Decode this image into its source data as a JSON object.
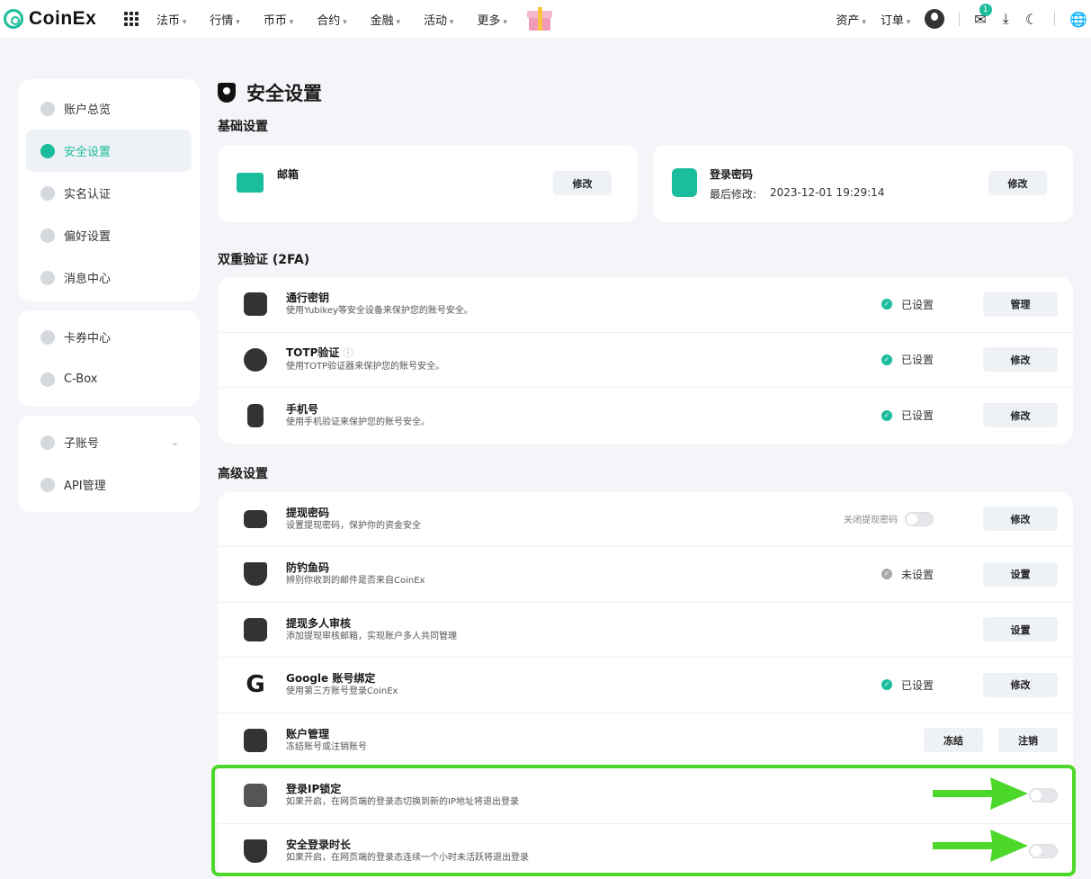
{
  "brand": {
    "name": "CoinEx"
  },
  "nav": [
    "法币",
    "行情",
    "币币",
    "合约",
    "金融",
    "活动",
    "更多"
  ],
  "topright": {
    "assets": "资产",
    "orders": "订单",
    "msg_count": "1"
  },
  "sidebar": {
    "group1": [
      "账户总览",
      "安全设置",
      "实名认证",
      "偏好设置",
      "消息中心"
    ],
    "group2": [
      "卡券中心",
      "C-Box"
    ],
    "group3": [
      "子账号",
      "API管理"
    ]
  },
  "page": {
    "title": "安全设置",
    "basic": {
      "title": "基础设置",
      "email": {
        "label": "邮箱",
        "button": "修改"
      },
      "password": {
        "label": "登录密码",
        "last_modified_label": "最后修改:",
        "last_modified": "2023-12-01 19:29:14",
        "button": "修改"
      }
    },
    "twofa": {
      "title": "双重验证 (2FA)",
      "rows": [
        {
          "title": "通行密钥",
          "desc": "使用Yubikey等安全设备来保护您的账号安全。",
          "status": "已设置",
          "button": "管理"
        },
        {
          "title": "TOTP验证",
          "desc": "使用TOTP验证器来保护您的账号安全。",
          "status": "已设置",
          "button": "修改"
        },
        {
          "title": "手机号",
          "desc": "使用手机验证来保护您的账号安全。",
          "status": "已设置",
          "button": "修改"
        }
      ]
    },
    "advanced": {
      "title": "高级设置",
      "withdraw_toggle_label": "关闭提现密码",
      "rows": [
        {
          "title": "提现密码",
          "desc": "设置提现密码，保护你的资金安全",
          "button": "修改"
        },
        {
          "title": "防钓鱼码",
          "desc": "辨别你收到的邮件是否来自CoinEx",
          "status": "未设置",
          "button": "设置"
        },
        {
          "title": "提现多人审核",
          "desc": "添加提现审核邮箱，实现账户多人共同管理",
          "button": "设置"
        },
        {
          "title": "Google 账号绑定",
          "desc": "使用第三方账号登录CoinEx",
          "status": "已设置",
          "button": "修改"
        },
        {
          "title": "账户管理",
          "desc": "冻结账号或注销账号",
          "button": "注销",
          "button2": "冻结"
        },
        {
          "title": "登录IP锁定",
          "desc": "如果开启，在网页端的登录态切换到新的IP地址将退出登录"
        },
        {
          "title": "安全登录时长",
          "desc": "如果开启，在网页端的登录态连续一个小时未活跃将退出登录"
        }
      ]
    }
  },
  "colors": {
    "accent": "#1bbd9c",
    "highlight": "#4cd82a"
  }
}
